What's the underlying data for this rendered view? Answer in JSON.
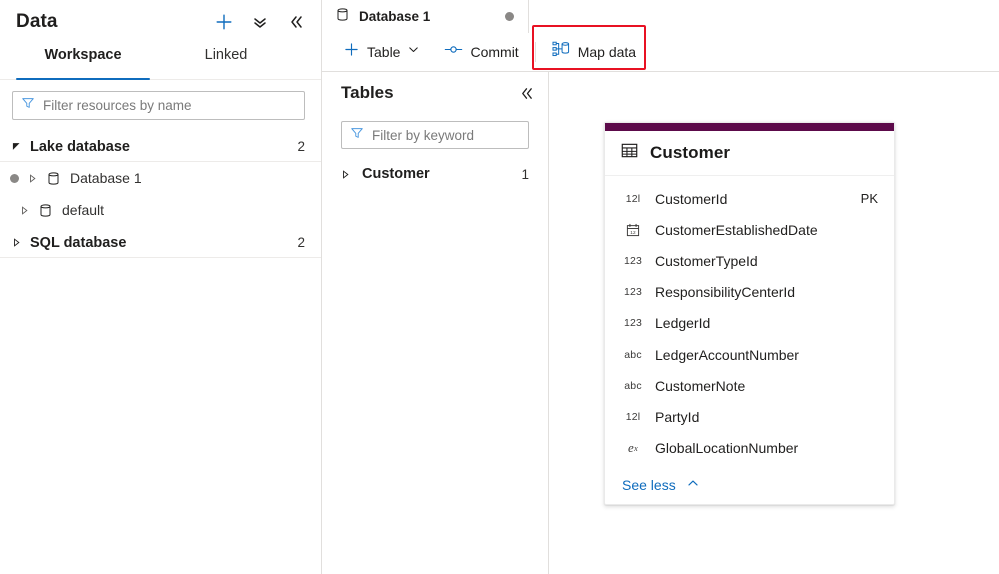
{
  "sidebar": {
    "title": "Data",
    "actions": [
      {
        "name": "add-icon",
        "glyph": "plus"
      },
      {
        "name": "expand-all-icon",
        "glyph": "double-chevron-down"
      },
      {
        "name": "collapse-panel-icon",
        "glyph": "double-chevron-left"
      }
    ],
    "tabs": [
      {
        "label": "Workspace",
        "active": true
      },
      {
        "label": "Linked",
        "active": false
      }
    ],
    "filter": {
      "placeholder": "Filter resources by name",
      "value": ""
    },
    "tree": [
      {
        "label": "Lake database",
        "count": "2",
        "expanded": true,
        "children": [
          {
            "label": "Database 1",
            "selected": true,
            "expanded": false
          },
          {
            "label": "default",
            "selected": false,
            "expanded": false
          }
        ]
      },
      {
        "label": "SQL database",
        "count": "2",
        "expanded": false,
        "children": []
      }
    ]
  },
  "document_tab": {
    "label": "Database 1",
    "unsaved": true
  },
  "toolbar": {
    "new_table_label": "Table",
    "commit_label": "Commit",
    "map_data_label": "Map data",
    "highlight_color": "#e81123",
    "highlighted_item": "Map data"
  },
  "tables_pane": {
    "title": "Tables",
    "filter": {
      "placeholder": "Filter by keyword",
      "value": ""
    },
    "rows": [
      {
        "name": "Customer",
        "count": "1"
      }
    ]
  },
  "entity_card": {
    "accent_color": "#5c0a4a",
    "title": "Customer",
    "fields": [
      {
        "type": "12l",
        "name": "CustomerId",
        "key": "PK"
      },
      {
        "type": "date",
        "name": "CustomerEstablishedDate",
        "key": ""
      },
      {
        "type": "123",
        "name": "CustomerTypeId",
        "key": ""
      },
      {
        "type": "123",
        "name": "ResponsibilityCenterId",
        "key": ""
      },
      {
        "type": "123",
        "name": "LedgerId",
        "key": ""
      },
      {
        "type": "abc",
        "name": "LedgerAccountNumber",
        "key": ""
      },
      {
        "type": "abc",
        "name": "CustomerNote",
        "key": ""
      },
      {
        "type": "12l",
        "name": "PartyId",
        "key": ""
      },
      {
        "type": "ex",
        "name": "GlobalLocationNumber",
        "key": ""
      }
    ],
    "footer_label": "See less"
  }
}
